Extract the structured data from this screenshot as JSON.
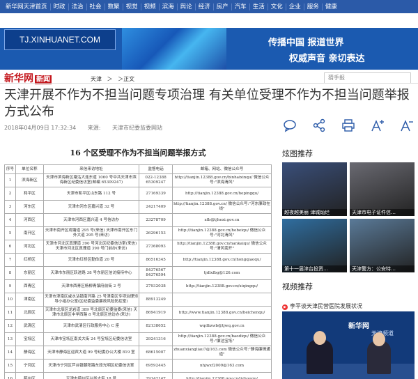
{
  "topnav": [
    "新华网天津首页",
    "时政",
    "法治",
    "社会",
    "数聚",
    "视觉",
    "视频",
    "滨海",
    "舆论",
    "经济",
    "房产",
    "汽车",
    "生活",
    "文化",
    "企业",
    "服务",
    "健康"
  ],
  "banner": {
    "logo": "TJ.XINHUANET.COM",
    "slogan1": "传播中国  报道世界",
    "slogan2": "权威声音  亲切表达"
  },
  "site": {
    "logo": "新华网",
    "logo_tag": "新闻"
  },
  "breadcrumb": [
    "天津",
    "＞",
    "＞正文"
  ],
  "search_placeholder": "猜手报",
  "article": {
    "title": "天津开展不作为不担当问题专项治理 有关单位受理不作为不担当问题举报方式公布",
    "date": "2018年04月09日 17:32:34",
    "source_label": "来源:",
    "source": "天津市纪委监委网站"
  },
  "tools": [
    "comment-icon",
    "share-icon",
    "print-icon",
    "font-larger-icon",
    "font-smaller-icon"
  ],
  "table": {
    "title": "16 个区受理不作为不担当问题举报方式",
    "headers": [
      "序号",
      "单位名称",
      "来信来访地址",
      "监督电话",
      "邮箱、网站、微信公众号"
    ],
    "rows": [
      [
        "1",
        "滨海新区",
        "天津市滨海新区塘沽大连东道 1060 号中共天津市滨海新区纪委信访室(邮编 65309247)",
        "022-12388 65309247",
        "http://tianjin.12388.gov.cn/binhaixinqu/ 微信公众号:\"滨海清风\""
      ],
      [
        "2",
        "和平区",
        "天津市和平区山东路 112 号",
        "27169339",
        "http://tianjin.12388.gov.cn/hepingqu/"
      ],
      [
        "3",
        "河东区",
        "天津市河东区嘉兴道 32 号",
        "24217409",
        "http://tianjin.12388.gov.cn/ 微信公众号:\"河东廉政在线\""
      ],
      [
        "4",
        "河西区",
        "天津市河西区嘉兴道 4 号信访办",
        "23278709",
        "xfb@tjhexi.gov.cn"
      ],
      [
        "5",
        "南开区",
        "天津市南开区观塘道 295 号(来信) 天津市南开区东门外大道 295 号(来访)",
        "26296153",
        "http://tianjin.12388.gov.cn/hebeiqu/ 微信公众号:\"河北清风\""
      ],
      [
        "6",
        "河北区",
        "天津市河北区真理道 390 号河北区纪委信访室(来信) 天津市河北区真理道 390 号门前办(来访)",
        "27368093",
        "http://tianjin.12388.gov.cn/nankaiqu/ 微信公众号:\"清风南开\""
      ],
      [
        "7",
        "红桥区",
        "天津市红桥区勤俭道 20 号",
        "86516345",
        "http://tianjin.12388.gov.cn/hongqiaoqu/"
      ],
      [
        "8",
        "东丽区",
        "天津市东丽区跃进路 38 号东丽区信访接待中心",
        "84376567 84376594",
        "tjdlxfbg@126.com"
      ],
      [
        "9",
        "西青区",
        "天津市西青区杨柳青镇府前街 2 号",
        "27932038",
        "http://tianjin.12388.gov.cn/xiqingqu/"
      ],
      [
        "10",
        "津南区",
        "天津市津南区咸水沽镇南环路 25 号津南区专项治理领导小组办公室(区纪委监委廉政风险防控室)",
        "88913249",
        ""
      ],
      [
        "11",
        "北辰区",
        "天津市北辰区龙岩道 389 号北辰区纪委监委(来信) 天津市北辰区中学西路 8 号北辰区信访办(来访)",
        "86941919",
        "http://www.tianjin.12388.gov.cn/beichenqu/"
      ],
      [
        "12",
        "武清区",
        "天津市武清区行政服务中心 C 座",
        "82138652",
        "wqdbzwb@tjwq.gov.cn"
      ],
      [
        "13",
        "宝坻区",
        "天津市宝坻区南关大街 24 号宝坻区纪委信访室",
        "29241316",
        "http://tianjin.12388.gov.cn/baodiqu/ 微信公众号:\"廉洁宝坻\""
      ],
      [
        "14",
        "静海区",
        "天津市静海区迎宾大道 99 号纪委办公大楼 819 室",
        "68615007",
        "zhuanxiangliau7@163.com 微信公众号:\"静海廉情通道\""
      ],
      [
        "15",
        "宁河区",
        "天津市宁河区芦台镇朝阳路东段光明区纪委信访室",
        "69592445",
        "nhjwxf2009@163.com"
      ],
      [
        "16",
        "蓟州区",
        "天津市蓟州区兴华大街 18 号",
        "29142147",
        "http://tianjin.12388.gov.cn/jizhouqu/"
      ]
    ]
  },
  "sidebar": {
    "photo_head": "炫图推荐",
    "photos": [
      {
        "caption": "越夜越美丽  津城灿烂",
        "color": "#3a4f7a"
      },
      {
        "caption": "天津市电子证件信…",
        "color": "#6a6a72"
      },
      {
        "caption": "第十一届津台投资…",
        "color": "#2f6ea0"
      },
      {
        "caption": "天津警方：公安特…",
        "color": "#5a7a98"
      }
    ],
    "video_head": "视频推荐",
    "video_caption": "李平谈天津民营医院发展状况",
    "video_brand": "新华网",
    "video_brand2": "天津频道"
  }
}
